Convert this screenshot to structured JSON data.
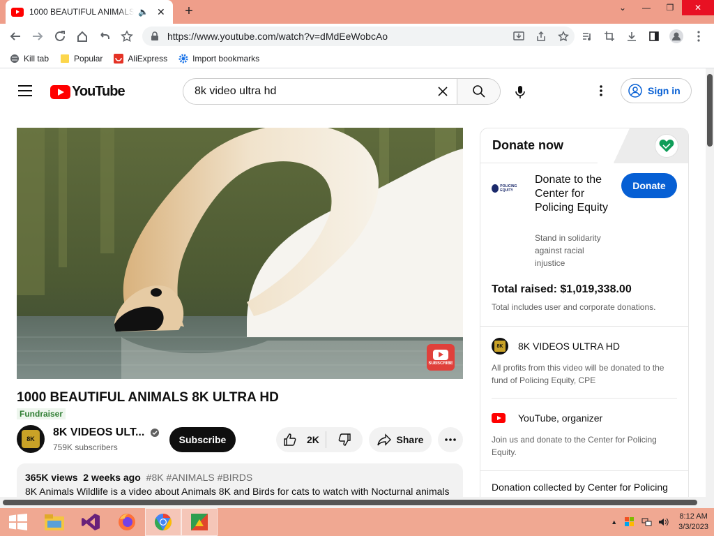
{
  "browser": {
    "tab_title": "1000 BEAUTIFUL ANIMALS 8K ULTRA HD",
    "url": "https://www.youtube.com/watch?v=dMdEeWobcAo",
    "bookmarks": [
      {
        "label": "Kill tab"
      },
      {
        "label": "Popular"
      },
      {
        "label": "AliExpress"
      },
      {
        "label": "Import bookmarks"
      }
    ]
  },
  "header": {
    "logo": "YouTube",
    "search_value": "8k video ultra hd",
    "signin_label": "Sign in"
  },
  "video": {
    "title": "1000 BEAUTIFUL ANIMALS 8K ULTRA HD",
    "badge": "Fundraiser",
    "watermark": "SUBSCRIBE",
    "channel_name": "8K VIDEOS ULT...",
    "channel_avatar_text": "8K",
    "subscribers": "759K subscribers",
    "subscribe_label": "Subscribe",
    "likes": "2K",
    "share_label": "Share",
    "views": "365K views",
    "age": "2 weeks ago",
    "tags": "#8K #ANIMALS #BIRDS",
    "description": "8K Animals Wildlife is a video about Animals 8K and Birds for cats to watch with Nocturnal animals"
  },
  "donate": {
    "header": "Donate now",
    "org_logo_text": "POLICING EQUITY",
    "org_name": "Donate to the Center for Policing Equity",
    "org_sub": "Stand in solidarity against racial injustice",
    "button_label": "Donate",
    "total_raised": "Total raised: $1,019,338.00",
    "total_note": "Total includes user and corporate donations.",
    "entries": [
      {
        "name": "8K VIDEOS ULTRA HD",
        "suffix": "",
        "text": "All profits from this video will be donated to the fund of Policing Equity, CPE"
      },
      {
        "name": "YouTube",
        "suffix": ", organizer",
        "text": "Join us and donate to the Center for Policing Equity."
      }
    ],
    "footer": "Donation collected by Center for Policing"
  },
  "taskbar": {
    "time": "8:12 AM",
    "date": "3/3/2023"
  },
  "colors": {
    "brand_red": "#ff0000",
    "link_blue": "#065fd4",
    "titlebar": "#ef9e8a",
    "taskbar": "#f0a892"
  }
}
